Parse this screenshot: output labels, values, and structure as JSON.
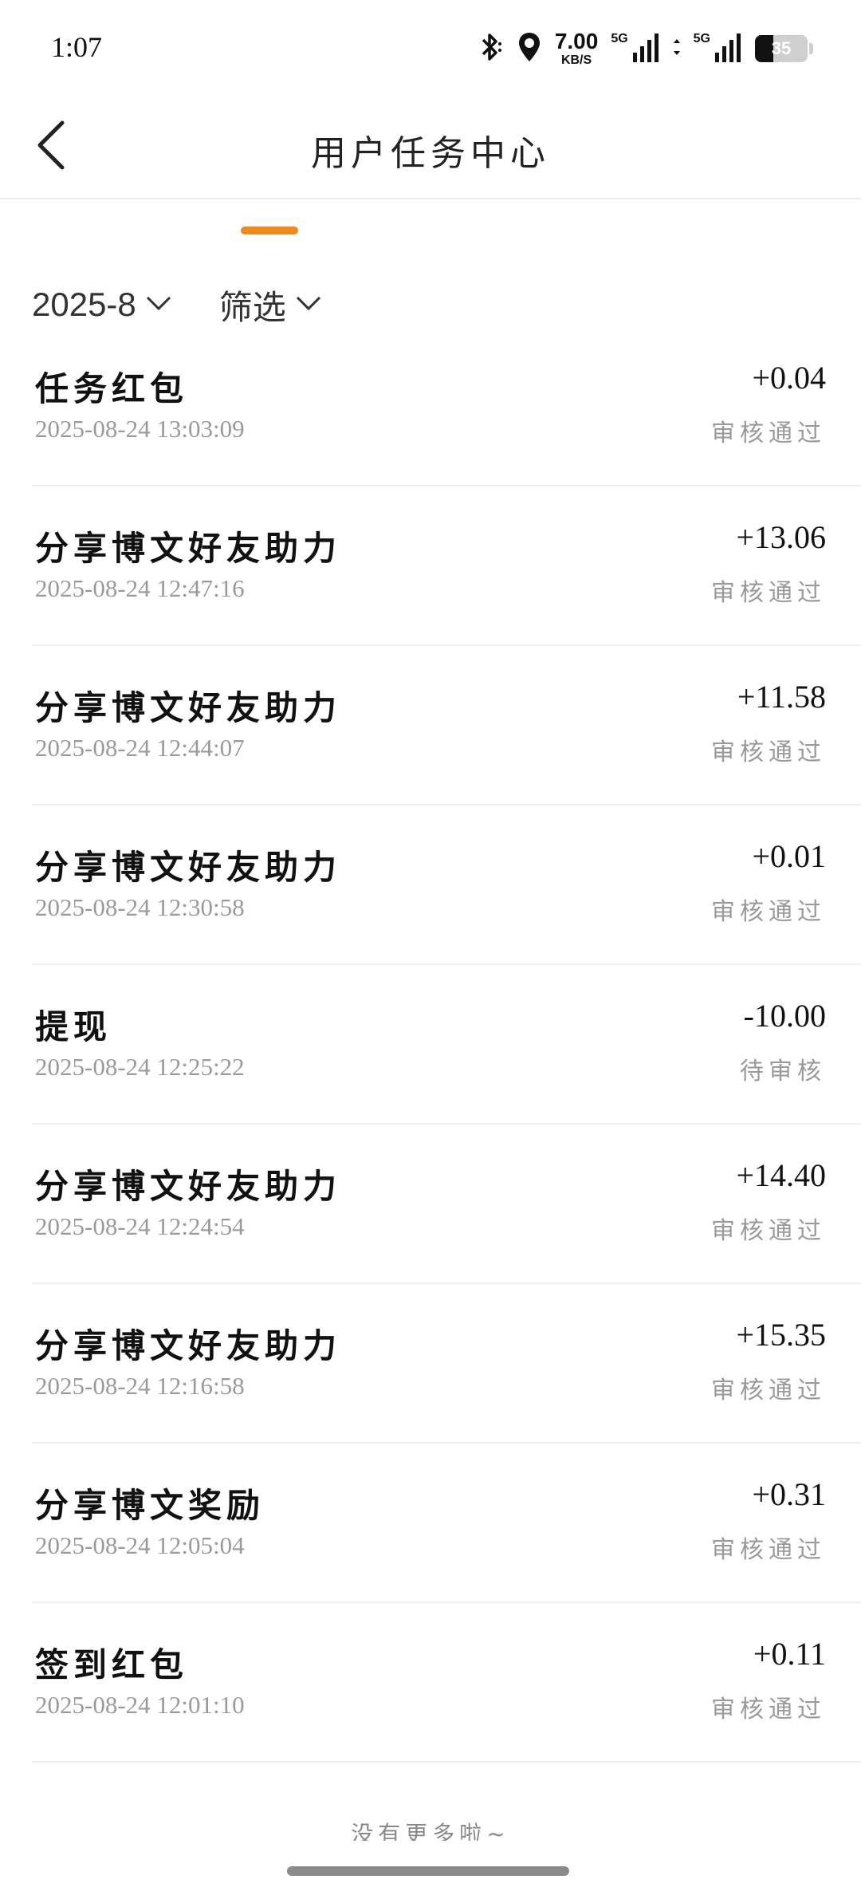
{
  "status_bar": {
    "time": "1:07",
    "net_speed_value": "7.00",
    "net_speed_unit": "KB/S",
    "network_1": "5G",
    "network_2": "5G",
    "battery": "35"
  },
  "header": {
    "title": "用户任务中心"
  },
  "filters": {
    "month": "2025-8",
    "filter_label": "筛选"
  },
  "records": [
    {
      "title": "任务红包",
      "time": "2025-08-24 13:03:09",
      "amount": "+0.04",
      "status": "审核通过"
    },
    {
      "title": "分享博文好友助力",
      "time": "2025-08-24 12:47:16",
      "amount": "+13.06",
      "status": "审核通过"
    },
    {
      "title": "分享博文好友助力",
      "time": "2025-08-24 12:44:07",
      "amount": "+11.58",
      "status": "审核通过"
    },
    {
      "title": "分享博文好友助力",
      "time": "2025-08-24 12:30:58",
      "amount": "+0.01",
      "status": "审核通过"
    },
    {
      "title": "提现",
      "time": "2025-08-24 12:25:22",
      "amount": "-10.00",
      "status": "待审核"
    },
    {
      "title": "分享博文好友助力",
      "time": "2025-08-24 12:24:54",
      "amount": "+14.40",
      "status": "审核通过"
    },
    {
      "title": "分享博文好友助力",
      "time": "2025-08-24 12:16:58",
      "amount": "+15.35",
      "status": "审核通过"
    },
    {
      "title": "分享博文奖励",
      "time": "2025-08-24 12:05:04",
      "amount": "+0.31",
      "status": "审核通过"
    },
    {
      "title": "签到红包",
      "time": "2025-08-24 12:01:10",
      "amount": "+0.11",
      "status": "审核通过"
    }
  ],
  "footer_note": "没有更多啦~",
  "colors": {
    "accent": "#f08a1c",
    "secondary_text": "#9a9a9a",
    "divider": "#eeeeee"
  }
}
